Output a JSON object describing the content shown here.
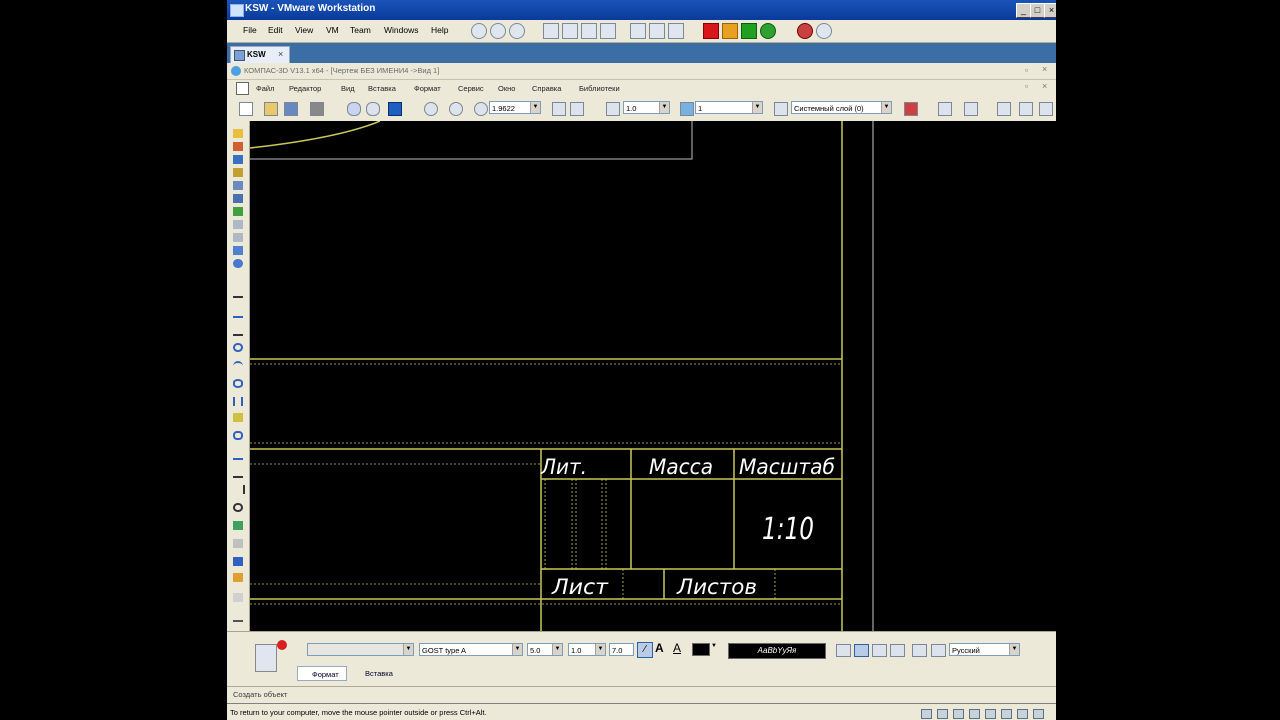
{
  "vmware": {
    "title": "KSW - VMware Workstation",
    "menu": [
      "File",
      "Edit",
      "View",
      "VM",
      "Team",
      "Windows",
      "Help"
    ],
    "tab_label": "KSW",
    "tab_close": "×",
    "window_buttons": [
      "_",
      "□",
      "×"
    ],
    "status_hint": "To return to your computer, move the mouse pointer outside or press Ctrl+Alt."
  },
  "kompas": {
    "title": "КОМПАС-3D V13.1 x64 - [Чертеж БЕЗ ИМЕНИ4 ->Вид 1]",
    "menu": [
      "Файл",
      "Редактор",
      "Вид",
      "Вставка",
      "Формат",
      "Сервис",
      "Окно",
      "Справка",
      "Библиотеки"
    ],
    "toolbar": {
      "zoom_value": "1.9622",
      "step_value": "1.0",
      "layer_number": "1",
      "layer_name": "Системный слой (0)"
    },
    "format_panel": {
      "font_name": "GOST type A",
      "font_size": "5.0",
      "line_spacing": "1.0",
      "char_width": "7.0",
      "language": "Русский",
      "preview_text": "AaBbYyЯя",
      "tabs": [
        "Формат",
        "Вставка"
      ]
    },
    "status_text": "Создать объект"
  },
  "title_block": {
    "lit": "Лит.",
    "mass": "Масса",
    "scale_header": "Масштаб",
    "scale_value": "1:10",
    "sheet": "Лист",
    "sheets": "Листов"
  },
  "colors": {
    "frame_line": "#c8c85a",
    "drawing_bg": "#000000",
    "text": "#ffffff",
    "vm_title": "#0a3a9a"
  }
}
